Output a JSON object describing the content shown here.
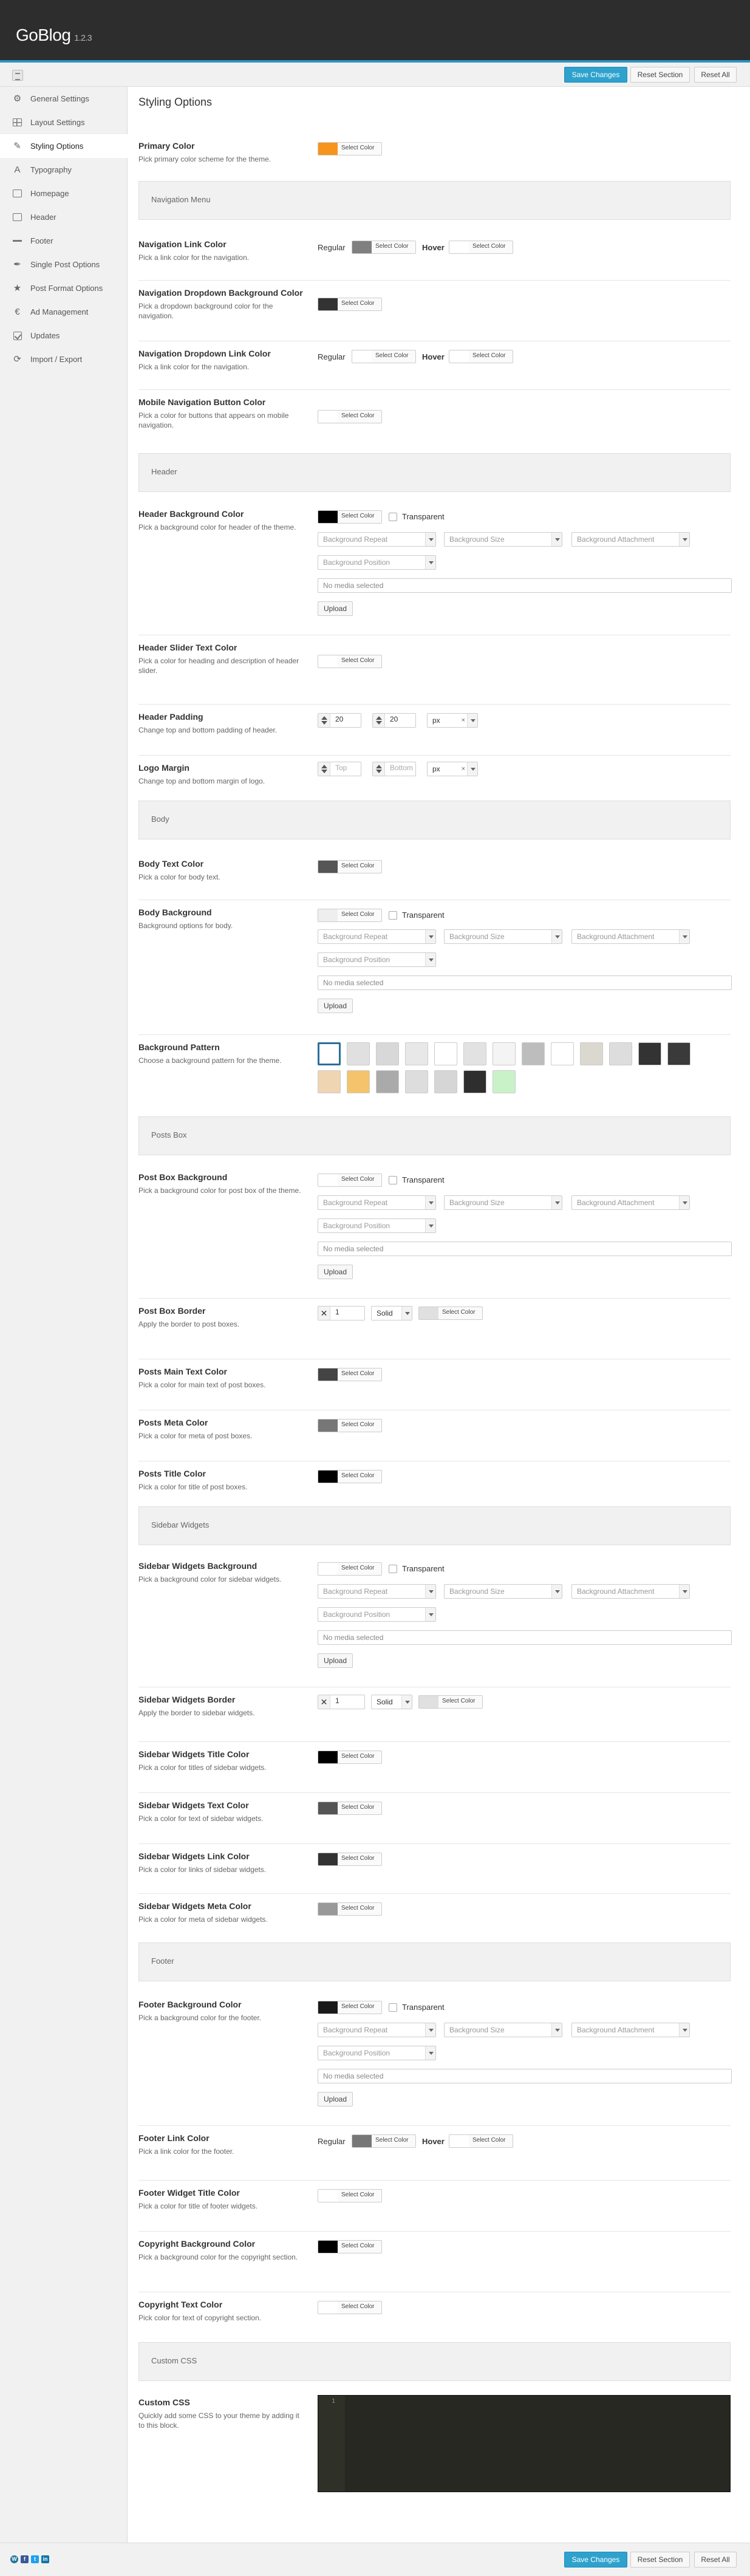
{
  "app": {
    "name": "GoBlog",
    "version": "1.2.3"
  },
  "actions": {
    "save": "Save Changes",
    "reset_section": "Reset Section",
    "reset_all": "Reset All"
  },
  "sidebar": {
    "items": [
      {
        "label": "General Settings",
        "icon": "gear-icon"
      },
      {
        "label": "Layout Settings",
        "icon": "layout-icon"
      },
      {
        "label": "Styling Options",
        "icon": "brush-icon"
      },
      {
        "label": "Typography",
        "icon": "typography-icon"
      },
      {
        "label": "Homepage",
        "icon": "home-icon"
      },
      {
        "label": "Header",
        "icon": "header-icon"
      },
      {
        "label": "Footer",
        "icon": "footer-icon"
      },
      {
        "label": "Single Post Options",
        "icon": "pin-icon"
      },
      {
        "label": "Post Format Options",
        "icon": "star-icon"
      },
      {
        "label": "Ad Management",
        "icon": "euro-icon"
      },
      {
        "label": "Updates",
        "icon": "checkbox-icon"
      },
      {
        "label": "Import / Export",
        "icon": "refresh-icon"
      }
    ]
  },
  "page": {
    "title": "Styling Options"
  },
  "common": {
    "select_color": "Select Color",
    "transparent": "Transparent",
    "bg_repeat": "Background Repeat",
    "bg_size": "Background Size",
    "bg_attachment": "Background Attachment",
    "bg_position": "Background Position",
    "no_media": "No media selected",
    "upload": "Upload",
    "regular": "Regular",
    "hover": "Hover",
    "px": "px",
    "top_ph": "Top",
    "bottom_ph": "Bottom",
    "solid": "Solid"
  },
  "sections": {
    "nav": "Navigation Menu",
    "header": "Header",
    "body": "Body",
    "posts": "Posts Box",
    "sidebar": "Sidebar Widgets",
    "footer": "Footer",
    "css": "Custom CSS"
  },
  "fields": {
    "primary": {
      "label": "Primary Color",
      "desc": "Pick primary color scheme for the theme.",
      "color": "#f7941d"
    },
    "nav_link": {
      "label": "Navigation Link Color",
      "desc": "Pick a link color for the navigation.",
      "regular": "#808080",
      "hover": "#ffffff"
    },
    "nav_dd_bg": {
      "label": "Navigation Dropdown Background Color",
      "desc": "Pick a dropdown background color for the navigation.",
      "color": "#333333"
    },
    "nav_dd_link": {
      "label": "Navigation Dropdown Link Color",
      "desc": "Pick a link color for the navigation.",
      "regular": "#ffffff",
      "hover": "#ffffff"
    },
    "mobile_nav": {
      "label": "Mobile Navigation Button Color",
      "desc": "Pick a color for buttons that appears on mobile navigation.",
      "color": "#ffffff"
    },
    "header_bg": {
      "label": "Header Background Color",
      "desc": "Pick a background color for header of the theme.",
      "color": "#000000"
    },
    "header_slider": {
      "label": "Header Slider Text Color",
      "desc": "Pick a color for heading and description of header slider.",
      "color": "#ffffff"
    },
    "header_padding": {
      "label": "Header Padding",
      "desc": "Change top and bottom padding of header.",
      "top": "20",
      "bottom": "20"
    },
    "logo_margin": {
      "label": "Logo Margin",
      "desc": "Change top and bottom margin of logo."
    },
    "body_text": {
      "label": "Body Text Color",
      "desc": "Pick a color for body text.",
      "color": "#555555"
    },
    "body_bg": {
      "label": "Body Background",
      "desc": "Background options for body.",
      "color": "#eeeeee"
    },
    "bg_pattern": {
      "label": "Background Pattern",
      "desc": "Choose a background pattern for the theme.",
      "row1": [
        "#ffffff",
        "#e0e0e0",
        "#d8d8d8",
        "#e8e8e8",
        "#ffffff",
        "#e2e2e2",
        "#f4f4f4",
        "#bdbdbd",
        "#ffffff",
        "#dbd8cf",
        "#dddddd",
        "#333333",
        "#3a3a3a"
      ],
      "row2": [
        "#f0d5b2",
        "#f4c36c",
        "#aaaaaa",
        "#dddddd",
        "#d6d6d6",
        "#2e2e2e",
        "#c9f2c9"
      ]
    },
    "posts_bg": {
      "label": "Post Box Background",
      "desc": "Pick a background color for post box of the theme.",
      "color": "#ffffff"
    },
    "posts_border": {
      "label": "Post Box Border",
      "desc": "Apply the border to post boxes.",
      "width": "1",
      "color": "#e0e0e0"
    },
    "posts_main_text": {
      "label": "Posts Main Text Color",
      "desc": "Pick a color for main text of post boxes.",
      "color": "#444444"
    },
    "posts_meta": {
      "label": "Posts Meta Color",
      "desc": "Pick a color for meta of post boxes.",
      "color": "#777777"
    },
    "posts_title": {
      "label": "Posts Title Color",
      "desc": "Pick a color for title of post boxes.",
      "color": "#000000"
    },
    "sw_bg": {
      "label": "Sidebar Widgets Background",
      "desc": "Pick a background color for sidebar widgets.",
      "color": "#ffffff"
    },
    "sw_border": {
      "label": "Sidebar Widgets Border",
      "desc": "Apply the border to sidebar widgets.",
      "width": "1",
      "color": "#e0e0e0"
    },
    "sw_title": {
      "label": "Sidebar Widgets Title Color",
      "desc": "Pick a color for titles of sidebar widgets.",
      "color": "#000000"
    },
    "sw_text": {
      "label": "Sidebar Widgets Text Color",
      "desc": "Pick a color for text of sidebar widgets.",
      "color": "#555555"
    },
    "sw_link": {
      "label": "Sidebar Widgets Link Color",
      "desc": "Pick a color for links of sidebar widgets.",
      "color": "#333333"
    },
    "sw_meta": {
      "label": "Sidebar Widgets Meta Color",
      "desc": "Pick a color for meta of sidebar widgets.",
      "color": "#999999"
    },
    "footer_bg": {
      "label": "Footer Background Color",
      "desc": "Pick a background color for the footer.",
      "color": "#1a1a1a"
    },
    "footer_link": {
      "label": "Footer Link Color",
      "desc": "Pick a link color for the footer.",
      "regular": "#777777",
      "hover": "#ffffff"
    },
    "footer_widget_title": {
      "label": "Footer Widget Title Color",
      "desc": "Pick a color for title of footer widgets.",
      "color": "#ffffff"
    },
    "copyright_bg": {
      "label": "Copyright Background Color",
      "desc": "Pick a background color for the copyright section.",
      "color": "#000000"
    },
    "copyright_text": {
      "label": "Copyright Text Color",
      "desc": "Pick color for text of copyright section.",
      "color": "#ffffff"
    },
    "custom_css": {
      "label": "Custom CSS",
      "desc": "Quickly add some CSS to your theme by adding it to this block.",
      "line": "1"
    }
  },
  "social": [
    "wordpress-icon",
    "facebook-icon",
    "twitter-icon",
    "linkedin-icon"
  ]
}
